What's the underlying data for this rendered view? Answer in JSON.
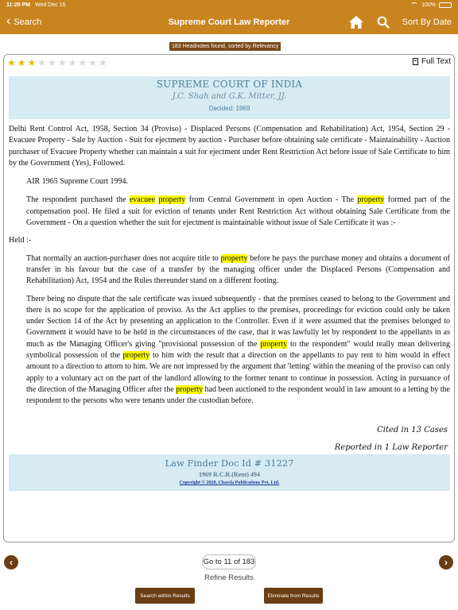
{
  "status_bar": {
    "time": "11:29 PM",
    "date": "Wed Dec 16",
    "battery": "100%"
  },
  "nav": {
    "back_label": "Search",
    "title": "Supreme Court Law Reporter",
    "sort_label": "Sort By Date"
  },
  "results_banner": "183 Headnotes found, sorted by Relevancy",
  "rating": {
    "stars_on": 3,
    "stars_total": 10
  },
  "full_text_label": "Full Text",
  "court": {
    "name": "SUPREME COURT OF INDIA",
    "judges": "J.C. Shah and G.K. Mitter, JJ.",
    "decided": "Decided: 1969"
  },
  "headnote": {
    "intro": "Delhi Rent Control Act, 1958, Section 34 (Proviso) - Displaced Persons (Compensation and Rehabilitation) Act, 1954, Section 29 - Evacuee Property - Sale by Auction - Suit for ejectment by auction - Purchaser before obtaining sale certificate - Maintainability - Auction purchaser of Evacuee Property whether can maintain a suit for ejectment under Rent Restriction Act before issue of Sale Certificate to him by the Government (Yes), Followed.",
    "air": "AIR 1965 Supreme Court 1994.",
    "p1_a": "The respondent purchased the ",
    "p1_h1": "evacuee",
    "p1_b": " ",
    "p1_h2": "property",
    "p1_c": " from Central Government in open Auction - The ",
    "p1_h3": "property",
    "p1_d": " formed part of the compensation pool. He filed a suit for eviction of tenants under Rent Restriction Act without obtaining Sale Certificate from the Government - On a question whether the suit for ejectment is maintainable without issue of Sale Certificate it was :-",
    "held": "Held :-",
    "p2_a": "That normally an auction-purchaser does not acquire title to ",
    "p2_h1": "property",
    "p2_b": " before he pays the purchase money and obtains a document of transfer in his favour but the case of a transfer by the managing officer under the Displaced Persons (Compensation and Rehabilitation) Act, 1954 and the Rules thereunder stand on a different footing.",
    "p3_a": "There being no dispute that the sale certificate was issued subsequently - that the premises ceased to belong to the Government and there is no scope for the application of proviso. As the Act applies to the premises, proceedings for eviction could only be taken under Section 14 of the Act by presenting an application to the Controller. Even if it were assumed that the premises belonged to Government it would have to be held in the circumstances of the case, that it was lawfully let by respondent to the appellants in as much as the Managing Officer's giving \"provisional possession of the ",
    "p3_h1": "property",
    "p3_b": " to the respondent\" would really mean delivering symbolical possession of the ",
    "p3_h2": "property",
    "p3_c": " to him with the result that a direction on the appellants to pay rent to him would in effect amount to a direction to attorn to him. We are not impressed by the argument that 'letting' within the meaning of the proviso can only apply to a voluntary act on the part of the landlord allowing to the former tenant to continue in possession. Acting in pursuance of the direction of the Managing Officer after the ",
    "p3_h3": "property",
    "p3_d": " had been auctioned to the respondent would in law amount to a letting by the respondent to the persons who were tenants under the custodian before."
  },
  "cited_in": "Cited in 13 Cases",
  "reported_in": "Reported in 1 Law Reporter",
  "law_finder": {
    "doc_id": "Law Finder Doc Id # 31227",
    "citation": "1969 R.C.R.(Rent) 494",
    "copyright": "Copyright © 2020, Chawla Publications Pvt. Ltd."
  },
  "pager": {
    "goto_label": "Go to 11 of 183",
    "refine_label": "Refine Results",
    "prev_icon": "‹",
    "next_icon": "›"
  },
  "buttons": {
    "search_within": "Search within Results",
    "eliminate": "Eliminate from Results"
  },
  "colors": {
    "brand": "#c8841f",
    "dark_brown": "#6b3d12",
    "highlight": "#ffff00",
    "header_bg": "#d6ebf2"
  },
  "icons": {
    "back": "chevron-left-icon",
    "home": "home-icon",
    "search": "search-icon",
    "full_text": "document-icon"
  }
}
